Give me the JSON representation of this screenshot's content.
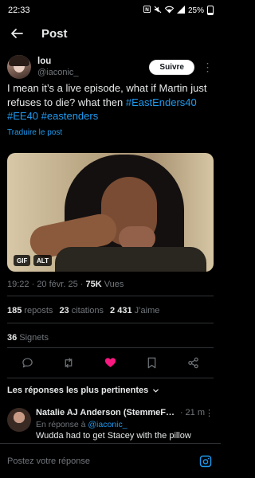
{
  "status": {
    "time": "22:33",
    "icons": [
      "nfc-icon",
      "mute-icon",
      "wifi-icon",
      "signal-icon"
    ],
    "battery": "25%"
  },
  "header": {
    "title": "Post"
  },
  "tweet": {
    "author_name": "lou",
    "author_handle": "@iaconic_",
    "follow_label": "Suivre",
    "text_plain": "I mean it’s a live episode, what if Martin just refuses to die? what then ",
    "hashtags": [
      "#EastEnders40",
      "#EE40",
      "#eastenders"
    ],
    "translate_label": "Traduire le post",
    "media_badges": {
      "gif": "GIF",
      "alt": "ALT"
    },
    "time": "19:22",
    "date": "20 févr. 25",
    "views_count": "75K",
    "views_label": "Vues",
    "reposts_count": "185",
    "reposts_label": "reposts",
    "quotes_count": "23",
    "quotes_label": "citations",
    "likes_count": "2 431",
    "likes_label": "J’aime",
    "bookmarks_count": "36",
    "bookmarks_label": "Signets"
  },
  "replies": {
    "heading": "Les réponses les plus pertinentes",
    "items": [
      {
        "name": "Natalie AJ Anderson (StemmeFa...",
        "time": "· 21 m",
        "reply_to_prefix": "En réponse à",
        "reply_to_handle": "@iaconic_",
        "text": "Wudda had to get Stacey with the pillow"
      }
    ]
  },
  "composer": {
    "placeholder": "Postez votre réponse"
  },
  "colors": {
    "accent": "#1d9bf0",
    "like": "#f91880",
    "bg": "#000000",
    "muted": "#71767b"
  }
}
